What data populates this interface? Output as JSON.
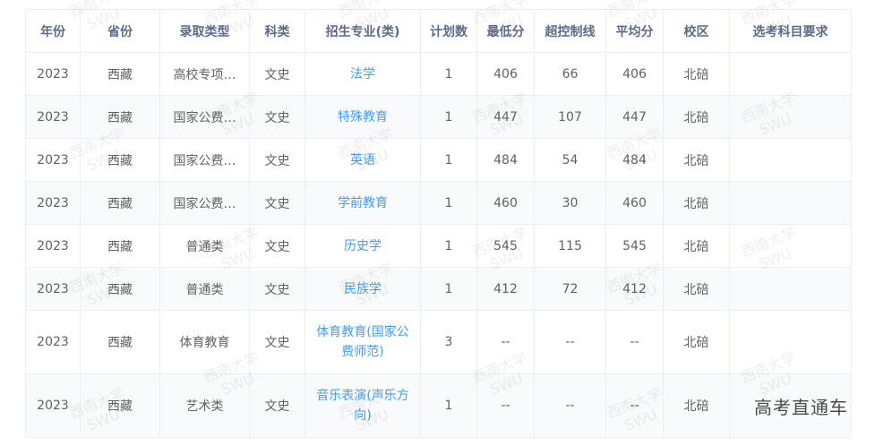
{
  "columns": [
    "年份",
    "省份",
    "录取类型",
    "科类",
    "招生专业(类)",
    "计划数",
    "最低分",
    "超控制线",
    "平均分",
    "校区",
    "选考科目要求"
  ],
  "rows": [
    {
      "year": "2023",
      "province": "西藏",
      "type": "高校专项…",
      "subject": "文史",
      "major": "法学",
      "plan": "1",
      "min": "406",
      "over": "66",
      "avg": "406",
      "campus": "北碚",
      "req": ""
    },
    {
      "year": "2023",
      "province": "西藏",
      "type": "国家公费…",
      "subject": "文史",
      "major": "特殊教育",
      "plan": "1",
      "min": "447",
      "over": "107",
      "avg": "447",
      "campus": "北碚",
      "req": ""
    },
    {
      "year": "2023",
      "province": "西藏",
      "type": "国家公费…",
      "subject": "文史",
      "major": "英语",
      "plan": "1",
      "min": "484",
      "over": "54",
      "avg": "484",
      "campus": "北碚",
      "req": ""
    },
    {
      "year": "2023",
      "province": "西藏",
      "type": "国家公费…",
      "subject": "文史",
      "major": "学前教育",
      "plan": "1",
      "min": "460",
      "over": "30",
      "avg": "460",
      "campus": "北碚",
      "req": ""
    },
    {
      "year": "2023",
      "province": "西藏",
      "type": "普通类",
      "subject": "文史",
      "major": "历史学",
      "plan": "1",
      "min": "545",
      "over": "115",
      "avg": "545",
      "campus": "北碚",
      "req": ""
    },
    {
      "year": "2023",
      "province": "西藏",
      "type": "普通类",
      "subject": "文史",
      "major": "民族学",
      "plan": "1",
      "min": "412",
      "over": "72",
      "avg": "412",
      "campus": "北碚",
      "req": ""
    },
    {
      "year": "2023",
      "province": "西藏",
      "type": "体育教育",
      "subject": "文史",
      "major": "体育教育(国家公费师范)",
      "plan": "3",
      "min": "--",
      "over": "--",
      "avg": "--",
      "campus": "北碚",
      "req": ""
    },
    {
      "year": "2023",
      "province": "西藏",
      "type": "艺术类",
      "subject": "文史",
      "major": "音乐表演(声乐方向)",
      "plan": "1",
      "min": "--",
      "over": "--",
      "avg": "--",
      "campus": "北碚",
      "req": ""
    }
  ],
  "watermark": {
    "line1": "西南大学",
    "line2": "SWU"
  },
  "brand_mark": "高考直通车"
}
